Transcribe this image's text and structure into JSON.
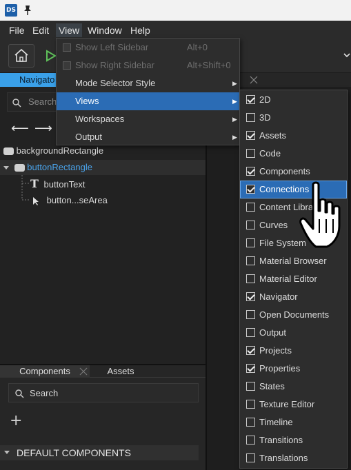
{
  "app": {
    "logo_text": "DS"
  },
  "menubar": {
    "items": [
      {
        "label": "File"
      },
      {
        "label": "Edit"
      },
      {
        "label": "View"
      },
      {
        "label": "Window"
      },
      {
        "label": "Help"
      }
    ]
  },
  "tabs": {
    "navigator": "Navigato"
  },
  "navigator": {
    "search_placeholder": "Search",
    "tree": [
      {
        "label": "backgroundRectangle"
      },
      {
        "label": "buttonRectangle"
      },
      {
        "label": "buttonText"
      },
      {
        "label": "button...seArea"
      }
    ]
  },
  "components_panel": {
    "tabs": [
      {
        "label": "Components"
      },
      {
        "label": "Assets"
      }
    ],
    "search_placeholder": "Search",
    "section_header": "DEFAULT COMPONENTS"
  },
  "view_menu": {
    "items": [
      {
        "label": "Show Left Sidebar",
        "shortcut": "Alt+0"
      },
      {
        "label": "Show Right Sidebar",
        "shortcut": "Alt+Shift+0"
      },
      {
        "label": "Mode Selector Style"
      },
      {
        "label": "Views"
      },
      {
        "label": "Workspaces"
      },
      {
        "label": "Output"
      }
    ]
  },
  "views_submenu": {
    "items": [
      {
        "label": "2D",
        "checked": true
      },
      {
        "label": "3D",
        "checked": false
      },
      {
        "label": "Assets",
        "checked": true
      },
      {
        "label": "Code",
        "checked": false
      },
      {
        "label": "Components",
        "checked": true
      },
      {
        "label": "Connections",
        "checked": true
      },
      {
        "label": "Content Libra",
        "checked": false
      },
      {
        "label": "Curves",
        "checked": false
      },
      {
        "label": "File System",
        "checked": false
      },
      {
        "label": "Material Browser",
        "checked": false
      },
      {
        "label": "Material Editor",
        "checked": false
      },
      {
        "label": "Navigator",
        "checked": true
      },
      {
        "label": "Open Documents",
        "checked": false
      },
      {
        "label": "Output",
        "checked": false
      },
      {
        "label": "Projects",
        "checked": true
      },
      {
        "label": "Properties",
        "checked": true
      },
      {
        "label": "States",
        "checked": false
      },
      {
        "label": "Texture Editor",
        "checked": false
      },
      {
        "label": "Timeline",
        "checked": false
      },
      {
        "label": "Transitions",
        "checked": false
      },
      {
        "label": "Translations",
        "checked": false
      }
    ]
  },
  "colors": {
    "highlight": "#2b6cb5",
    "tab_active": "#3aa0e8"
  }
}
